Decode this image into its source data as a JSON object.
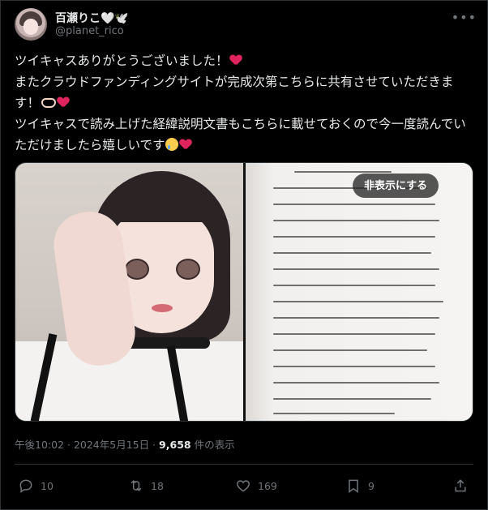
{
  "author": {
    "name": "百瀬りこ🤍🕊️",
    "handle": "@planet_rico"
  },
  "more_icon": "more-horizontal-icon",
  "tweet": {
    "lines": [
      "ツイキャスありがとうございました！",
      "またクラウドファンディングサイトが完成次第こちらに共有させていただきます！",
      "ツイキャスで読み上げた経緯説明文書もこちらに載せておくので今一度読んでいただけましたら嬉しいです"
    ]
  },
  "media": {
    "hide_button": "非表示にする"
  },
  "meta": {
    "time": "午後10:02 · 2024年5月15日 · ",
    "views": "9,658",
    "views_suffix": " 件の表示"
  },
  "actions": {
    "replies": "10",
    "retweets": "18",
    "likes": "169",
    "bookmarks": "9"
  },
  "colors": {
    "background": "#000000",
    "text": "#e7e9ea",
    "muted": "#71767b",
    "border": "#2f3336",
    "heart": "#e0245e"
  }
}
